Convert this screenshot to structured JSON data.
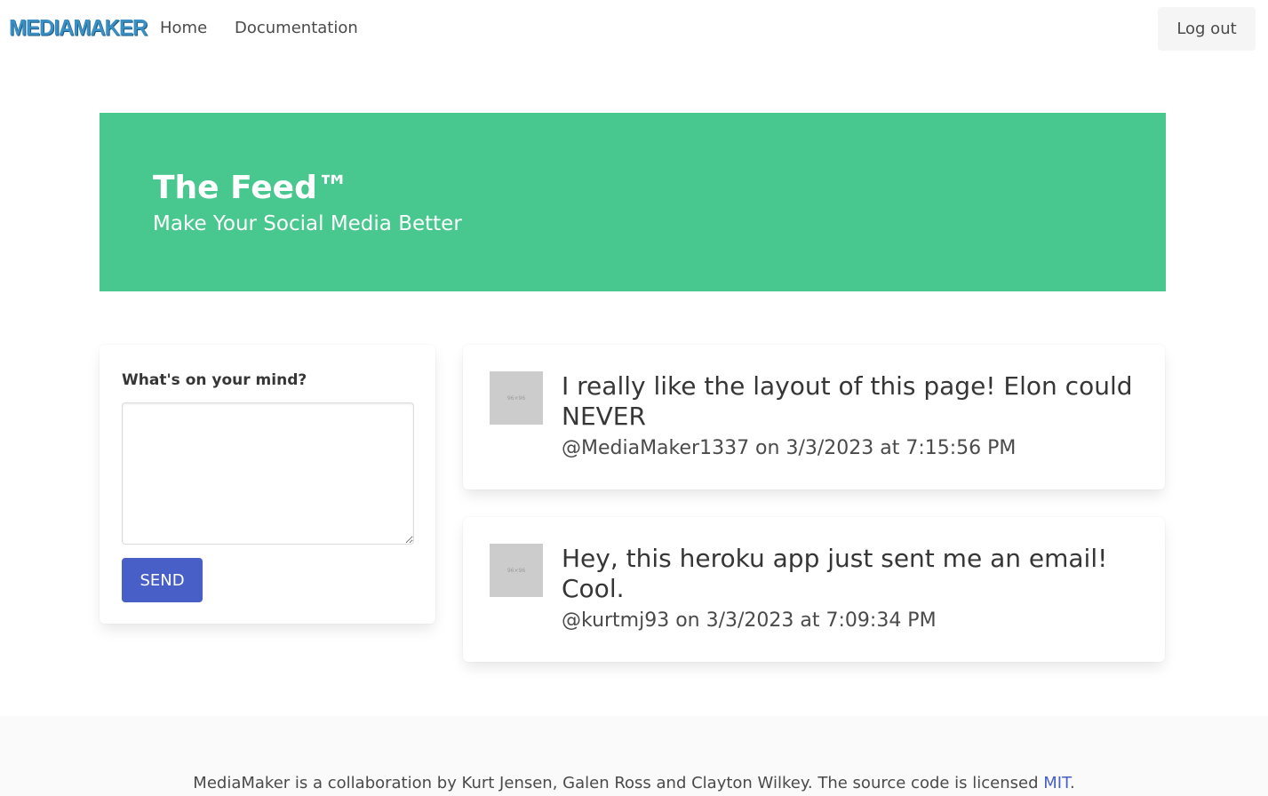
{
  "navbar": {
    "brand": "MEDIAMAKER",
    "links": [
      "Home",
      "Documentation"
    ],
    "logout_label": "Log out"
  },
  "hero": {
    "title": "The Feed™",
    "subtitle": "Make Your Social Media Better"
  },
  "compose": {
    "label": "What's on your mind?",
    "value": "",
    "send_label": "SEND"
  },
  "posts": [
    {
      "text": "I really like the layout of this page! Elon could NEVER",
      "meta": "@MediaMaker1337 on 3/3/2023 at 7:15:56 PM",
      "avatar_text": "96×96"
    },
    {
      "text": "Hey, this heroku app just sent me an email! Cool.",
      "meta": "@kurtmj93 on 3/3/2023 at 7:09:34 PM",
      "avatar_text": "96×96"
    }
  ],
  "footer": {
    "text_before": "MediaMaker is a collaboration by Kurt Jensen, Galen Ross and Clayton Wilkey. The source code is licensed ",
    "link_label": "MIT",
    "text_after": "."
  },
  "colors": {
    "hero_bg": "#48c78e",
    "primary_button": "#485fc7",
    "brand": "#3a8fc4"
  }
}
